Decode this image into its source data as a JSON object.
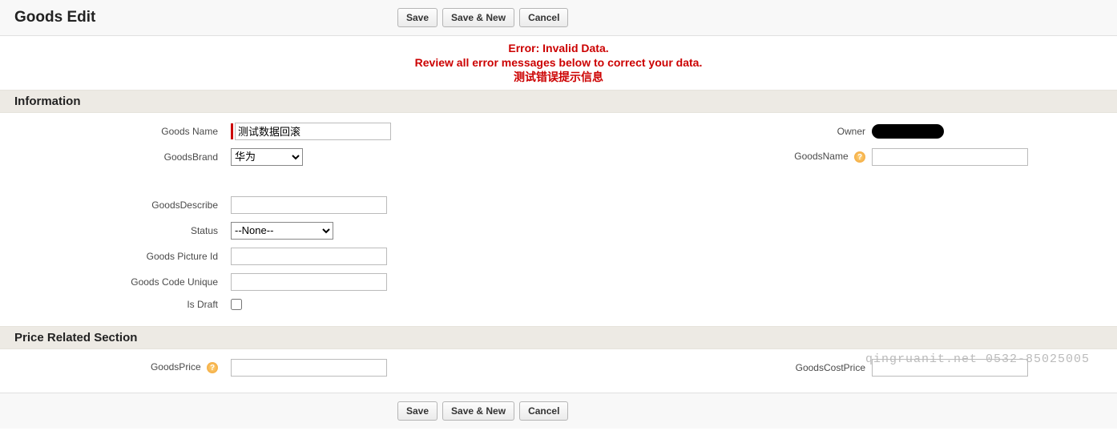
{
  "header": {
    "title": "Goods Edit",
    "save": "Save",
    "save_new": "Save & New",
    "cancel": "Cancel"
  },
  "error": {
    "line1": "Error: Invalid Data.",
    "line2": "Review all error messages below to correct your data.",
    "line3": "测试错误提示信息"
  },
  "sections": {
    "information": {
      "title": "Information",
      "fields": {
        "goods_name_label": "Goods Name",
        "goods_name_value": "测试数据回滚",
        "goods_brand_label": "GoodsBrand",
        "goods_brand_value": "华为",
        "owner_label": "Owner",
        "goods_name2_label": "GoodsName",
        "goods_describe_label": "GoodsDescribe",
        "goods_describe_value": "",
        "status_label": "Status",
        "status_value": "--None--",
        "goods_picture_id_label": "Goods Picture Id",
        "goods_picture_id_value": "",
        "goods_code_unique_label": "Goods Code Unique",
        "goods_code_unique_value": "",
        "is_draft_label": "Is Draft"
      }
    },
    "price": {
      "title": "Price Related Section",
      "fields": {
        "goods_price_label": "GoodsPrice",
        "goods_price_value": "",
        "goods_cost_price_label": "GoodsCostPrice",
        "goods_cost_price_value": ""
      }
    }
  },
  "footer": {
    "save": "Save",
    "save_new": "Save & New",
    "cancel": "Cancel"
  },
  "watermark": "qingruanit.net 0532-85025005",
  "help_glyph": "?"
}
